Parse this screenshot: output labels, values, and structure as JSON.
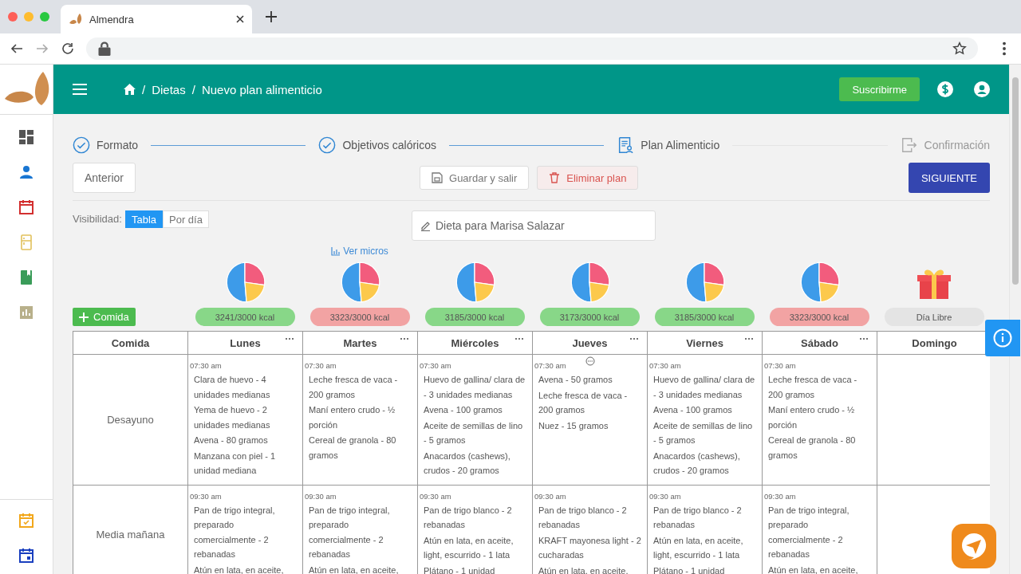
{
  "browser": {
    "tab_title": "Almendra"
  },
  "topbar": {
    "breadcrumb": [
      {
        "separator": "/",
        "label": "Dietas"
      },
      {
        "separator": "/",
        "label": "Nuevo plan alimenticio"
      }
    ],
    "subscribe_button": "Suscribirme"
  },
  "stepper": [
    {
      "label": "Formato",
      "kind": "done"
    },
    {
      "label": "Objetivos calóricos",
      "kind": "done"
    },
    {
      "label": "Plan Alimenticio",
      "kind": "current"
    },
    {
      "label": "Confirmación",
      "kind": "pending"
    }
  ],
  "actions": {
    "back": "Anterior",
    "save": "Guardar y salir",
    "delete": "Eliminar plan",
    "next": "SIGUIENTE"
  },
  "visibility": {
    "label": "Visibilidad:",
    "options": [
      {
        "label": "Tabla",
        "selected": true
      },
      {
        "label": "Por día",
        "selected": false
      }
    ]
  },
  "plan_title": "Dieta para Marisa Salazar",
  "micros_link": "Ver micros",
  "add_meal_button": "Comida",
  "table": {
    "first_column": "Comida",
    "days": [
      {
        "name": "Lunes",
        "summary": "3241/3000 kcal",
        "kind": "ok"
      },
      {
        "name": "Martes",
        "summary": "3323/3000 kcal",
        "kind": "over"
      },
      {
        "name": "Miércoles",
        "summary": "3185/3000 kcal",
        "kind": "ok"
      },
      {
        "name": "Jueves",
        "summary": "3173/3000 kcal",
        "kind": "ok"
      },
      {
        "name": "Viernes",
        "summary": "3185/3000 kcal",
        "kind": "ok"
      },
      {
        "name": "Sábado",
        "summary": "3323/3000 kcal",
        "kind": "over"
      },
      {
        "name": "Domingo",
        "summary": "Día Libre",
        "kind": "free"
      }
    ],
    "rows": [
      {
        "meal": "Desayuno",
        "cells": [
          {
            "time": "07:30 am",
            "items": [
              "Clara de huevo - 4 unidades medianas",
              "Yema de huevo - 2 unidades medianas",
              "Avena - 80 gramos",
              "Manzana con piel - 1 unidad mediana"
            ]
          },
          {
            "time": "07:30 am",
            "items": [
              "Leche fresca de vaca - 200 gramos",
              "Maní entero crudo - ½ porción",
              "Cereal de granola - 80 gramos"
            ]
          },
          {
            "time": "07:30 am",
            "items": [
              "Huevo de gallina/ clara de - 3 unidades medianas",
              "Avena - 100 gramos",
              "Aceite de semillas de lino - 5 gramos",
              "Anacardos (cashews), crudos - 20 gramos"
            ]
          },
          {
            "time": "07:30 am",
            "comment": true,
            "items": [
              "Avena - 50 gramos",
              "Leche fresca de vaca - 200 gramos",
              "Nuez - 15 gramos"
            ]
          },
          {
            "time": "07:30 am",
            "items": [
              "Huevo de gallina/ clara de - 3 unidades medianas",
              "Avena - 100 gramos",
              "Aceite de semillas de lino - 5 gramos",
              "Anacardos (cashews), crudos - 20 gramos"
            ]
          },
          {
            "time": "07:30 am",
            "items": [
              "Leche fresca de vaca - 200 gramos",
              "Maní entero crudo - ½ porción",
              "Cereal de granola - 80 gramos"
            ]
          },
          {}
        ]
      },
      {
        "meal": "Media mañana",
        "cells": [
          {
            "time": "09:30 am",
            "items": [
              "Pan de trigo integral, preparado comercialmente - 2 rebanadas",
              "Atún en lata, en aceite,"
            ]
          },
          {
            "time": "09:30 am",
            "items": [
              "Pan de trigo integral, preparado comercialmente - 2 rebanadas",
              "Atún en lata, en aceite,"
            ]
          },
          {
            "time": "09:30 am",
            "items": [
              "Pan de trigo blanco - 2 rebanadas",
              "Atún en lata, en aceite, light, escurrido - 1 lata",
              "Plátano - 1 unidad"
            ]
          },
          {
            "time": "09:30 am",
            "items": [
              "Pan de trigo blanco - 2 rebanadas",
              "KRAFT mayonesa light - 2 cucharadas",
              "Atún en lata, en aceite,"
            ]
          },
          {
            "time": "09:30 am",
            "items": [
              "Pan de trigo blanco - 2 rebanadas",
              "Atún en lata, en aceite, light, escurrido - 1 lata",
              "Plátano - 1 unidad"
            ]
          },
          {
            "time": "09:30 am",
            "items": [
              "Pan de trigo integral, preparado comercialmente - 2 rebanadas",
              "Atún en lata, en aceite,"
            ]
          },
          {}
        ]
      }
    ]
  }
}
